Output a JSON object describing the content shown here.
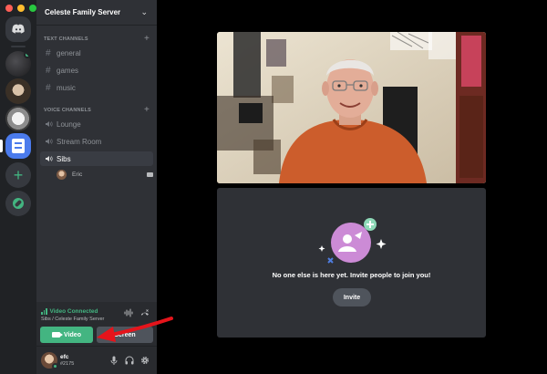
{
  "window": {
    "traffic_lights": [
      "close",
      "minimize",
      "zoom"
    ]
  },
  "rail": {
    "servers": [
      {
        "name": "home",
        "icon": "discord-logo-icon"
      },
      {
        "name": "server-1",
        "icon": "server-avatar"
      },
      {
        "name": "server-2",
        "icon": "server-avatar"
      },
      {
        "name": "server-3",
        "icon": "server-avatar"
      },
      {
        "name": "server-4",
        "icon": "document-icon",
        "active": true
      },
      {
        "name": "add-server",
        "icon": "plus-icon"
      },
      {
        "name": "explore",
        "icon": "compass-icon"
      }
    ]
  },
  "server": {
    "name": "Celeste Family Server"
  },
  "sidebar": {
    "text_category": "TEXT CHANNELS",
    "text_channels": [
      "general",
      "games",
      "music"
    ],
    "voice_category": "VOICE CHANNELS",
    "voice_channels": [
      "Lounge",
      "Stream Room",
      "Sibs"
    ],
    "selected_voice": "Sibs",
    "voice_members": [
      {
        "name": "Eric"
      }
    ]
  },
  "voice_panel": {
    "status": "Video Connected",
    "location": "Sibs / Celeste Family Server",
    "video_label": "Video",
    "screen_label": "Screen"
  },
  "user": {
    "name": "efc",
    "tag": "#2175"
  },
  "call": {
    "empty_message": "No one else is here yet. Invite people to join you!",
    "invite_label": "Invite"
  },
  "colors": {
    "green": "#43b581",
    "annotation_arrow": "#e5141b",
    "sidebar_bg": "#2f3136",
    "rail_bg": "#202225"
  }
}
